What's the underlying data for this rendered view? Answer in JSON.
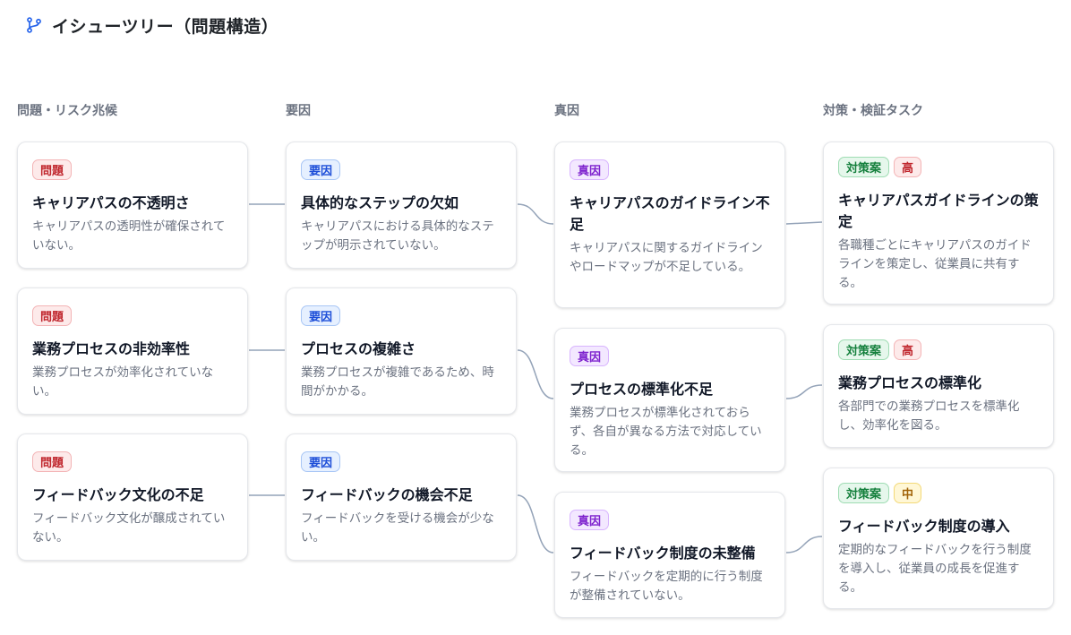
{
  "header": {
    "title": "イシューツリー（問題構造）",
    "icon": "git-branch-icon"
  },
  "columns": [
    {
      "title": "問題・リスク兆候"
    },
    {
      "title": "要因"
    },
    {
      "title": "真因"
    },
    {
      "title": "対策・検証タスク"
    }
  ],
  "cards": {
    "problems": [
      {
        "badge": "問題",
        "title": "キャリアパスの不透明さ",
        "desc": "キャリアパスの透明性が確保されていない。"
      },
      {
        "badge": "問題",
        "title": "業務プロセスの非効率性",
        "desc": "業務プロセスが効率化されていない。"
      },
      {
        "badge": "問題",
        "title": "フィードバック文化の不足",
        "desc": "フィードバック文化が醸成されていない。"
      }
    ],
    "factors": [
      {
        "badge": "要因",
        "title": "具体的なステップの欠如",
        "desc": "キャリアパスにおける具体的なステップが明示されていない。"
      },
      {
        "badge": "要因",
        "title": "プロセスの複雑さ",
        "desc": "業務プロセスが複雑であるため、時間がかかる。"
      },
      {
        "badge": "要因",
        "title": "フィードバックの機会不足",
        "desc": "フィードバックを受ける機会が少ない。"
      }
    ],
    "roots": [
      {
        "badge": "真因",
        "title": "キャリアパスのガイドライン不足",
        "desc": "キャリアパスに関するガイドラインやロードマップが不足している。"
      },
      {
        "badge": "真因",
        "title": "プロセスの標準化不足",
        "desc": "業務プロセスが標準化されておらず、各自が異なる方法で対応している。"
      },
      {
        "badge": "真因",
        "title": "フィードバック制度の未整備",
        "desc": "フィードバックを定期的に行う制度が整備されていない。"
      }
    ],
    "measures": [
      {
        "badge": "対策案",
        "priority": "高",
        "title": "キャリアパスガイドラインの策定",
        "desc": "各職種ごとにキャリアパスのガイドラインを策定し、従業員に共有する。"
      },
      {
        "badge": "対策案",
        "priority": "高",
        "title": "業務プロセスの標準化",
        "desc": "各部門での業務プロセスを標準化し、効率化を図る。"
      },
      {
        "badge": "対策案",
        "priority": "中",
        "title": "フィードバック制度の導入",
        "desc": "定期的なフィードバックを行う制度を導入し、従業員の成長を促進する。"
      }
    ]
  },
  "colors": {
    "connector": "#94a3b8"
  }
}
